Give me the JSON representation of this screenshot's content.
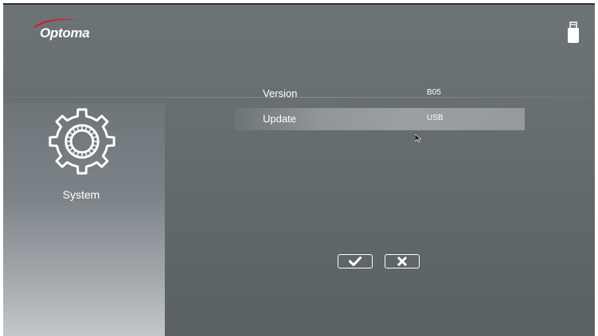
{
  "header": {
    "brand": "Optoma",
    "storage_icon": "usb-drive-icon"
  },
  "category": {
    "icon": "gear-icon",
    "label": "System"
  },
  "menu": {
    "items": [
      {
        "label": "Version",
        "value": "B05",
        "selected": false
      },
      {
        "label": "Update",
        "value": "USB",
        "selected": true
      }
    ]
  },
  "actions": {
    "confirm_icon": "checkmark-icon",
    "cancel_icon": "close-icon"
  },
  "colors": {
    "background": "#656c70",
    "text": "#ffffff",
    "brand_red": "#d4202a"
  }
}
